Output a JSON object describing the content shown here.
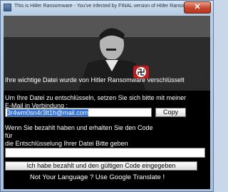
{
  "window": {
    "title": "This is Hitler Ransomware  -  You've infected by FINAL version of Hitler Ransomware!",
    "close_label": "✕"
  },
  "message": {
    "headline": "Ihre wichtige Datei wurde von Hitler Ransomware verschlüsselt",
    "instructions_line1": "Um Ihre Datei zu entschlüsseln, setzen Sie sich bitte mit meiner",
    "instructions_line2": "E-Mail in Verbindung :",
    "email": "3r4wm0sn4r3lt1h@mail.com",
    "copy_label": "Copy",
    "payment_line1": "Wenn Sie bezahlt haben und erhalten Sie den Code",
    "payment_line2": "für",
    "payment_line3": "die Entschlüsselung Ihrer Datei Bitte geben",
    "code_value": "",
    "submit_label": "Ich habe bezahlt und den gültigen Code eingegeben",
    "translate_note": "Not Your Language ? Use Google Translate !"
  },
  "colors": {
    "background": "#000000",
    "text": "#ffffff",
    "armband": "#b81c1c"
  }
}
